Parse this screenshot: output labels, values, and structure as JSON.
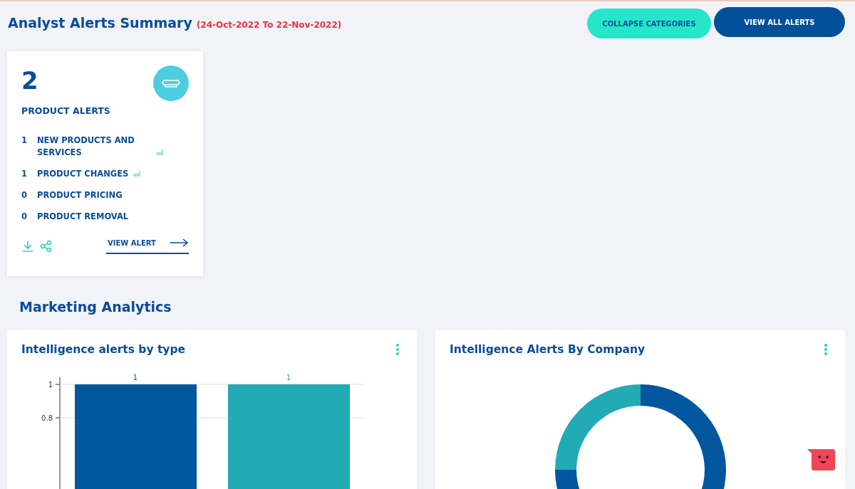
{
  "header": {
    "title": "Analyst Alerts Summary",
    "date_range": "(24-Oct-2022 To 22-Nov-2022)",
    "buttons": [
      {
        "label": "COLLAPSE CATEGORIES",
        "kind": "secondary"
      },
      {
        "label": "VIEW ALL ALERTS",
        "kind": "primary"
      }
    ]
  },
  "alert_card": {
    "count": "2",
    "title": "PRODUCT ALERTS",
    "items": [
      {
        "count": "1",
        "label": "NEW PRODUCTS AND SERVICES",
        "trend": true
      },
      {
        "count": "1",
        "label": "PRODUCT CHANGES",
        "trend": true
      },
      {
        "count": "0",
        "label": "PRODUCT PRICING",
        "trend": false
      },
      {
        "count": "0",
        "label": "PRODUCT REMOVAL",
        "trend": false
      }
    ],
    "link": "VIEW ALERT"
  },
  "section_title": "Marketing Analytics",
  "panels": [
    {
      "title": "Intelligence alerts by type",
      "kind": "bar",
      "chart_data": {
        "type": "bar",
        "values": [
          1,
          1
        ],
        "colors": [
          "#02579e",
          "#22aab5"
        ],
        "ylim": [
          0,
          1
        ],
        "yticks": [
          0.8,
          1
        ],
        "data_labels": true
      }
    },
    {
      "title": "Intelligence Alerts By Company",
      "kind": "donut"
    }
  ]
}
